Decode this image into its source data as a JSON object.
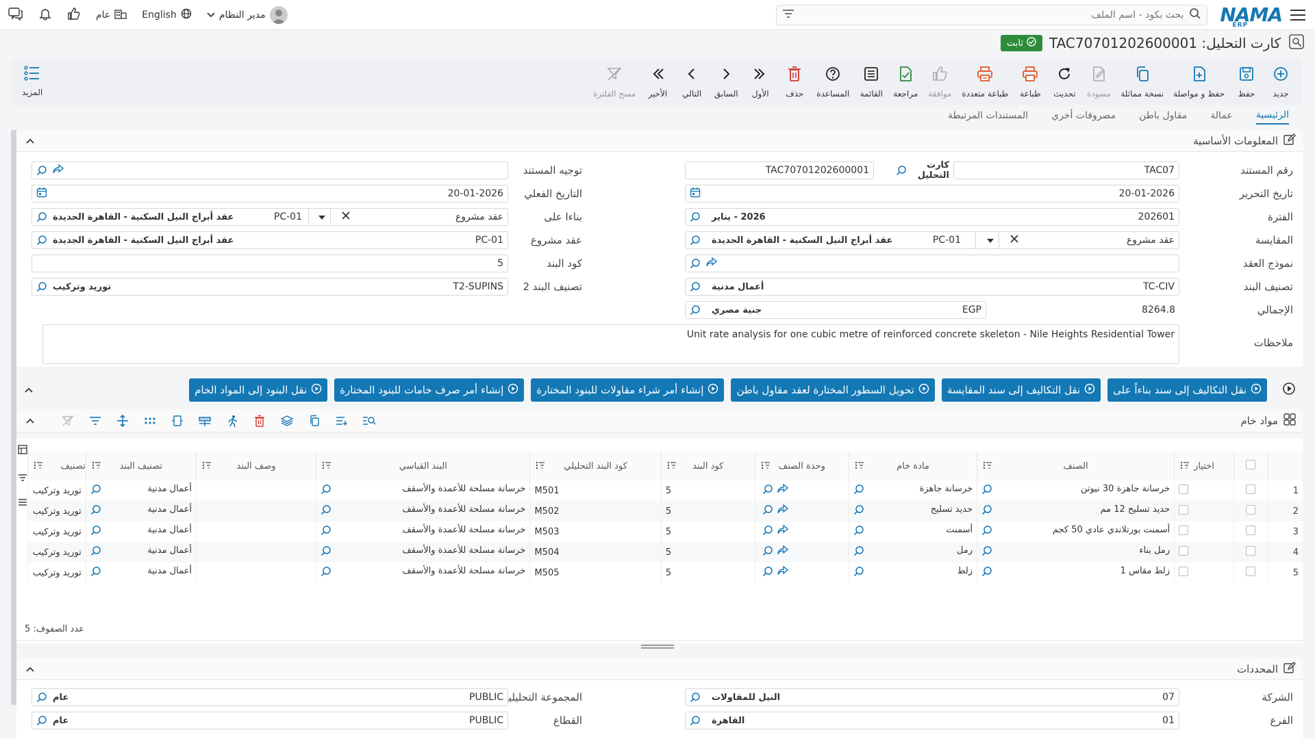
{
  "topbar": {
    "logo": "NAMA",
    "logo_sub": "ERP",
    "search_placeholder": "بحث بكود - اسم الملف",
    "user": "مدير النظام",
    "language": "English",
    "scope": "عام"
  },
  "doc": {
    "title": "كارت التحليل: TAC70701202600001",
    "status": "ثابت"
  },
  "toolbar": {
    "buttons": [
      {
        "label": "جديد",
        "icon": "plus-circle-icon",
        "color": "#1478b4"
      },
      {
        "label": "حفظ",
        "icon": "save-icon",
        "color": "#1478b4"
      },
      {
        "label": "حفظ و مواصلة",
        "icon": "save-continue-icon",
        "color": "#1478b4"
      },
      {
        "label": "نسخة مماثلة",
        "icon": "copy-icon",
        "color": "#1478b4"
      },
      {
        "label": "مسودة",
        "icon": "draft-icon",
        "color": "#aaaaaa"
      },
      {
        "label": "تحديث",
        "icon": "refresh-icon",
        "color": "#222222"
      },
      {
        "label": "طباعة",
        "icon": "print-icon",
        "color": "#e05a2b"
      },
      {
        "label": "طباعة متعددة",
        "icon": "multi-print-icon",
        "color": "#e05a2b"
      },
      {
        "label": "موافقة",
        "icon": "thumbs-up-icon",
        "color": "#aaaaaa"
      },
      {
        "label": "مراجعة",
        "icon": "review-icon",
        "color": "#2e8b3c"
      },
      {
        "label": "القائمة",
        "icon": "list-icon",
        "color": "#222222"
      },
      {
        "label": "المساعدة",
        "icon": "help-icon",
        "color": "#222222"
      },
      {
        "label": "حذف",
        "icon": "trash-icon",
        "color": "#d9342b"
      },
      {
        "label": "الأول",
        "icon": "first-icon",
        "color": "#222222"
      },
      {
        "label": "السابق",
        "icon": "prev-icon",
        "color": "#222222"
      },
      {
        "label": "التالي",
        "icon": "next-icon",
        "color": "#222222"
      },
      {
        "label": "الأخير",
        "icon": "last-icon",
        "color": "#222222"
      },
      {
        "label": "مسح الفلترة",
        "icon": "clear-filter-icon",
        "color": "#aaaaaa"
      }
    ],
    "more": "المزيد"
  },
  "tabs": [
    "الرئيسية",
    "عمالة",
    "مقاول باطن",
    "مصروفات أخري",
    "المستندات المرتبطة"
  ],
  "basic_info": {
    "title": "المعلومات الأساسية",
    "labels": {
      "doc_no": "رقم المستند",
      "edit_date": "تاريخ التحرير",
      "period": "الفترة",
      "measure": "المقايسة",
      "contract_model": "نموذج العقد",
      "item_class": "تصنيف البند",
      "total": "الإجمالي",
      "notes": "ملاحظات",
      "doc_direction": "توجيه المستند",
      "actual_date": "التاريخ الفعلي",
      "based_on": "بناءا على",
      "project_contract": "عقد مشروع",
      "item_code": "كود البند",
      "item_class2": "تصنيف البند 2"
    },
    "values": {
      "doc_no_code": "TAC07",
      "doc_no_type": "كارت التحليل",
      "doc_no_full": "TAC70701202600001",
      "edit_date": "20-01-2026",
      "period_code": "202601",
      "period_name": "2026 - يناير",
      "measure_type": "عقد مشروع",
      "measure_code": "PC-01",
      "measure_name": "عقد أبراج النيل السكنية - القاهرة الجديدة",
      "item_class_code": "TC-CIV",
      "item_class_name": "أعمال مدنية",
      "total": "8264.8",
      "currency_code": "EGP",
      "currency_name": "جنية مصري",
      "notes": "Unit rate analysis for one cubic metre of reinforced concrete skeleton - Nile Heights Residential Tower",
      "actual_date": "20-01-2026",
      "based_on_type": "عقد مشروع",
      "based_on_code": "PC-01",
      "based_on_name": "عقد أبراج النيل السكنية - القاهرة الجديدة",
      "project_contract_code": "PC-01",
      "project_contract_name": "عقد أبراج النيل السكنية - القاهرة الجديدة",
      "item_code": "5",
      "item_class2_code": "T2-SUPINS",
      "item_class2_name": "توريد وتركيب"
    }
  },
  "actions": [
    "نقل التكاليف إلى سند بناءاً على",
    "نقل التكاليف إلى سند المقايسة",
    "تحويل السطور المختارة لعقد مقاول باطن",
    "إنشاء أمر شراء مقاولات للبنود المختارة",
    "إنشاء أمر صرف خامات للبنود المختارة",
    "نقل البنود إلى المواد الخام"
  ],
  "raw_materials": {
    "title": "مواد خام",
    "columns": [
      "اختيار",
      "الصنف",
      "مادة خام",
      "وحدة الصنف",
      "كود البند",
      "كود البند التحليلي",
      "البند القياسي",
      "وصف البند",
      "تصنيف البند",
      "تصنيف"
    ],
    "rows": [
      {
        "n": "1",
        "item": "خرسانة جاهزة 30 نيوتن",
        "raw": "خرسانة جاهزة",
        "code": "5",
        "acode": "M501",
        "std": "خرسانة مسلحة للأعمدة والأسقف",
        "desc": "",
        "cls": "أعمال مدنية",
        "cls2": "توريد وتركيب"
      },
      {
        "n": "2",
        "item": "حديد تسليح 12 مم",
        "raw": "حديد تسليح",
        "code": "5",
        "acode": "M502",
        "std": "خرسانة مسلحة للأعمدة والأسقف",
        "desc": "",
        "cls": "أعمال مدنية",
        "cls2": "توريد وتركيب"
      },
      {
        "n": "3",
        "item": "أسمنت بورتلاندي عادي 50 كجم",
        "raw": "أسمنت",
        "code": "5",
        "acode": "M503",
        "std": "خرسانة مسلحة للأعمدة والأسقف",
        "desc": "",
        "cls": "أعمال مدنية",
        "cls2": "توريد وتركيب"
      },
      {
        "n": "4",
        "item": "رمل بناء",
        "raw": "رمل",
        "code": "5",
        "acode": "M504",
        "std": "خرسانة مسلحة للأعمدة والأسقف",
        "desc": "",
        "cls": "أعمال مدنية",
        "cls2": "توريد وتركيب"
      },
      {
        "n": "5",
        "item": "زلط مقاس 1",
        "raw": "زلط",
        "code": "5",
        "acode": "M505",
        "std": "خرسانة مسلحة للأعمدة والأسقف",
        "desc": "",
        "cls": "أعمال مدنية",
        "cls2": "توريد وتركيب"
      }
    ],
    "row_count": "عدد الصفوف: 5"
  },
  "dimensions": {
    "title": "المحددات",
    "labels": {
      "company": "الشركة",
      "branch": "الفرع",
      "analytic_group": "المجموعة التحليلية",
      "sector": "القطاع"
    },
    "values": {
      "company_code": "07",
      "company_name": "النيل للمقاولات",
      "branch_code": "01",
      "branch_name": "القاهرة",
      "group_code": "PUBLIC",
      "group_name": "عام",
      "sector_code": "PUBLIC",
      "sector_name": "عام"
    }
  }
}
